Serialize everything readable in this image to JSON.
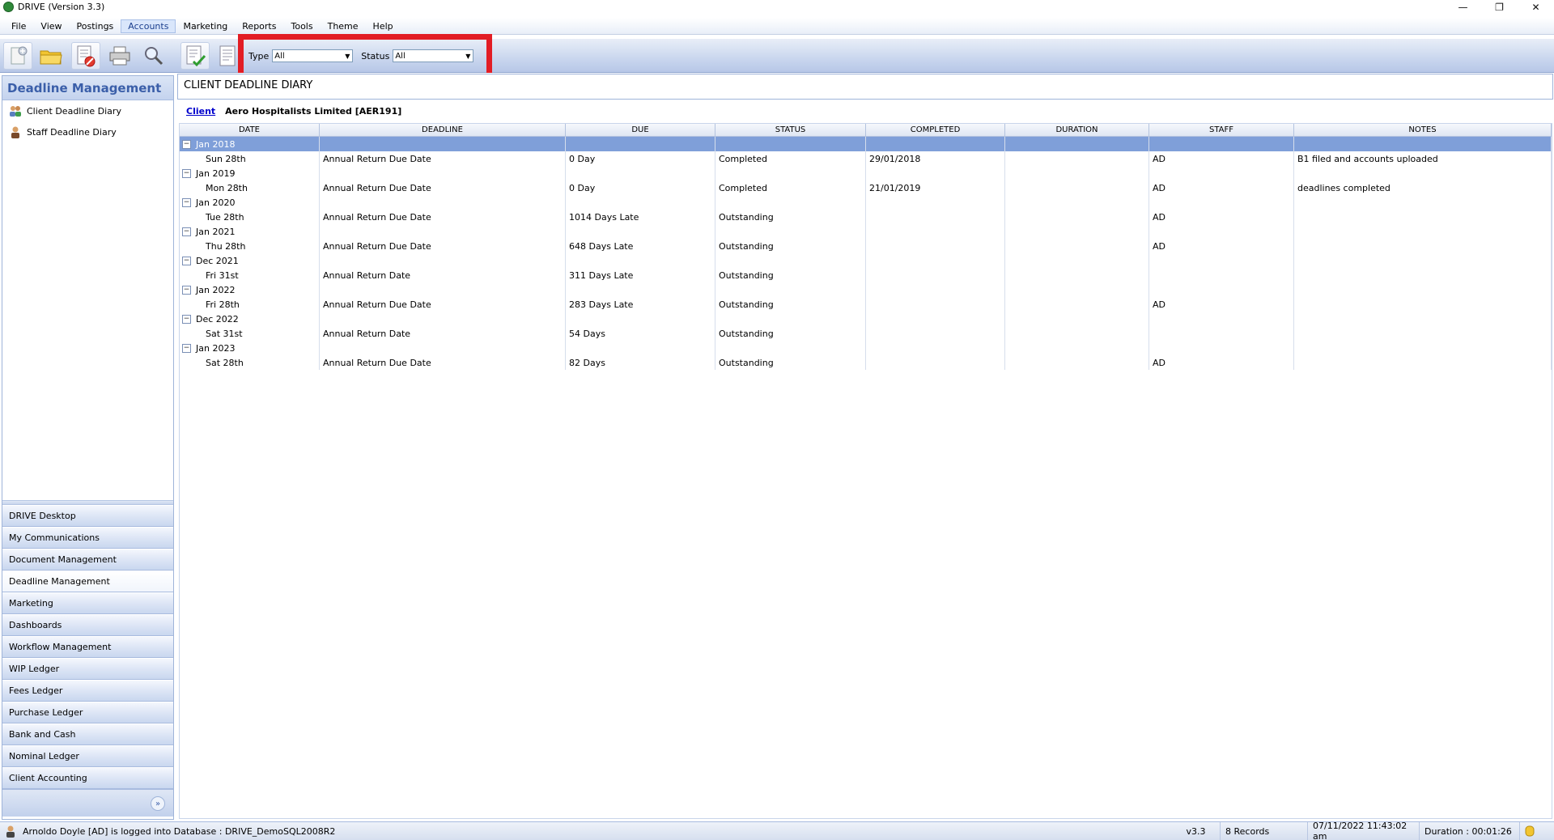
{
  "window": {
    "title": "DRIVE (Version 3.3)"
  },
  "menu": [
    "File",
    "View",
    "Postings",
    "Accounts",
    "Marketing",
    "Reports",
    "Tools",
    "Theme",
    "Help"
  ],
  "filters": {
    "type_label": "Type",
    "type_value": "All",
    "status_label": "Status",
    "status_value": "All"
  },
  "sidebar": {
    "title": "Deadline Management",
    "links": [
      "Client Deadline Diary",
      "Staff Deadline Diary"
    ],
    "nav": [
      "DRIVE Desktop",
      "My Communications",
      "Document Management",
      "Deadline Management",
      "Marketing",
      "Dashboards",
      "Workflow Management",
      "WIP Ledger",
      "Fees Ledger",
      "Purchase Ledger",
      "Bank and Cash",
      "Nominal Ledger",
      "Client Accounting"
    ]
  },
  "main": {
    "title": "CLIENT DEADLINE DIARY",
    "client_label": "Client",
    "client_name": "Aero Hospitalists Limited [AER191]"
  },
  "grid": {
    "columns": [
      "DATE",
      "DEADLINE",
      "DUE",
      "STATUS",
      "COMPLETED",
      "DURATION",
      "STAFF",
      "NOTES"
    ],
    "groups": [
      {
        "label": "Jan 2018",
        "row": {
          "date": "Sun 28th",
          "deadline": "Annual Return Due Date",
          "due": "0 Day",
          "status": "Completed",
          "completed": "29/01/2018",
          "duration": "",
          "staff": "AD",
          "notes": "B1 filed and accounts uploaded"
        }
      },
      {
        "label": "Jan 2019",
        "row": {
          "date": "Mon 28th",
          "deadline": "Annual Return Due Date",
          "due": "0 Day",
          "status": "Completed",
          "completed": "21/01/2019",
          "duration": "",
          "staff": "AD",
          "notes": "deadlines completed"
        }
      },
      {
        "label": "Jan 2020",
        "row": {
          "date": "Tue 28th",
          "deadline": "Annual Return Due Date",
          "due": "1014 Days Late",
          "status": "Outstanding",
          "completed": "",
          "duration": "",
          "staff": "AD",
          "notes": ""
        }
      },
      {
        "label": "Jan 2021",
        "row": {
          "date": "Thu 28th",
          "deadline": "Annual Return Due Date",
          "due": "648 Days Late",
          "status": "Outstanding",
          "completed": "",
          "duration": "",
          "staff": "AD",
          "notes": ""
        }
      },
      {
        "label": "Dec 2021",
        "row": {
          "date": "Fri 31st",
          "deadline": "Annual Return Date",
          "due": "311 Days Late",
          "status": "Outstanding",
          "completed": "",
          "duration": "",
          "staff": "",
          "notes": ""
        }
      },
      {
        "label": "Jan 2022",
        "row": {
          "date": "Fri 28th",
          "deadline": "Annual Return Due Date",
          "due": "283 Days Late",
          "status": "Outstanding",
          "completed": "",
          "duration": "",
          "staff": "AD",
          "notes": ""
        }
      },
      {
        "label": "Dec 2022",
        "row": {
          "date": "Sat 31st",
          "deadline": "Annual Return Date",
          "due": "54 Days",
          "status": "Outstanding",
          "completed": "",
          "duration": "",
          "staff": "",
          "notes": ""
        }
      },
      {
        "label": "Jan 2023",
        "row": {
          "date": "Sat 28th",
          "deadline": "Annual Return Due Date",
          "due": "82 Days",
          "status": "Outstanding",
          "completed": "",
          "duration": "",
          "staff": "AD",
          "notes": ""
        }
      }
    ]
  },
  "status": {
    "user": "Arnoldo Doyle [AD] is logged into Database : DRIVE_DemoSQL2008R2",
    "version": "v3.3",
    "records": "8 Records",
    "datetime": "07/11/2022 11:43:02 am",
    "duration": "Duration : 00:01:26"
  },
  "colors": {
    "accent": "#3b5fa9",
    "highlight": "#e21d25",
    "selected_row": "#7f9fd9"
  }
}
